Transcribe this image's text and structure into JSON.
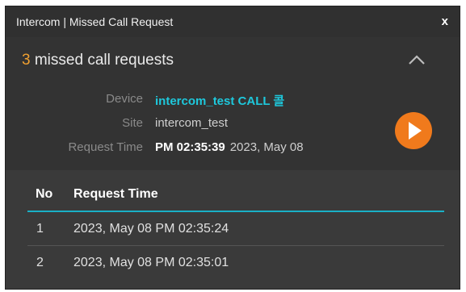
{
  "window": {
    "title": "Intercom | Missed Call Request",
    "close_label": "x"
  },
  "summary": {
    "count": "3",
    "label": " missed call requests"
  },
  "details": {
    "device_label": "Device",
    "device_value": "intercom_test CALL 콜",
    "site_label": "Site",
    "site_value": "intercom_test",
    "request_time_label": "Request Time",
    "request_time_value": "PM 02:35:39",
    "request_time_date": "2023, May 08"
  },
  "colors": {
    "accent_orange": "#f07a1c",
    "count_orange": "#f0a030",
    "accent_cyan": "#1ec8dc"
  },
  "icons": {
    "collapse": "chevron-up-icon",
    "play": "play-icon",
    "close": "close-icon"
  },
  "table": {
    "columns": [
      "No",
      "Request Time"
    ],
    "rows": [
      {
        "no": "1",
        "time": "2023, May 08 PM 02:35:24"
      },
      {
        "no": "2",
        "time": "2023, May 08 PM 02:35:01"
      }
    ]
  }
}
